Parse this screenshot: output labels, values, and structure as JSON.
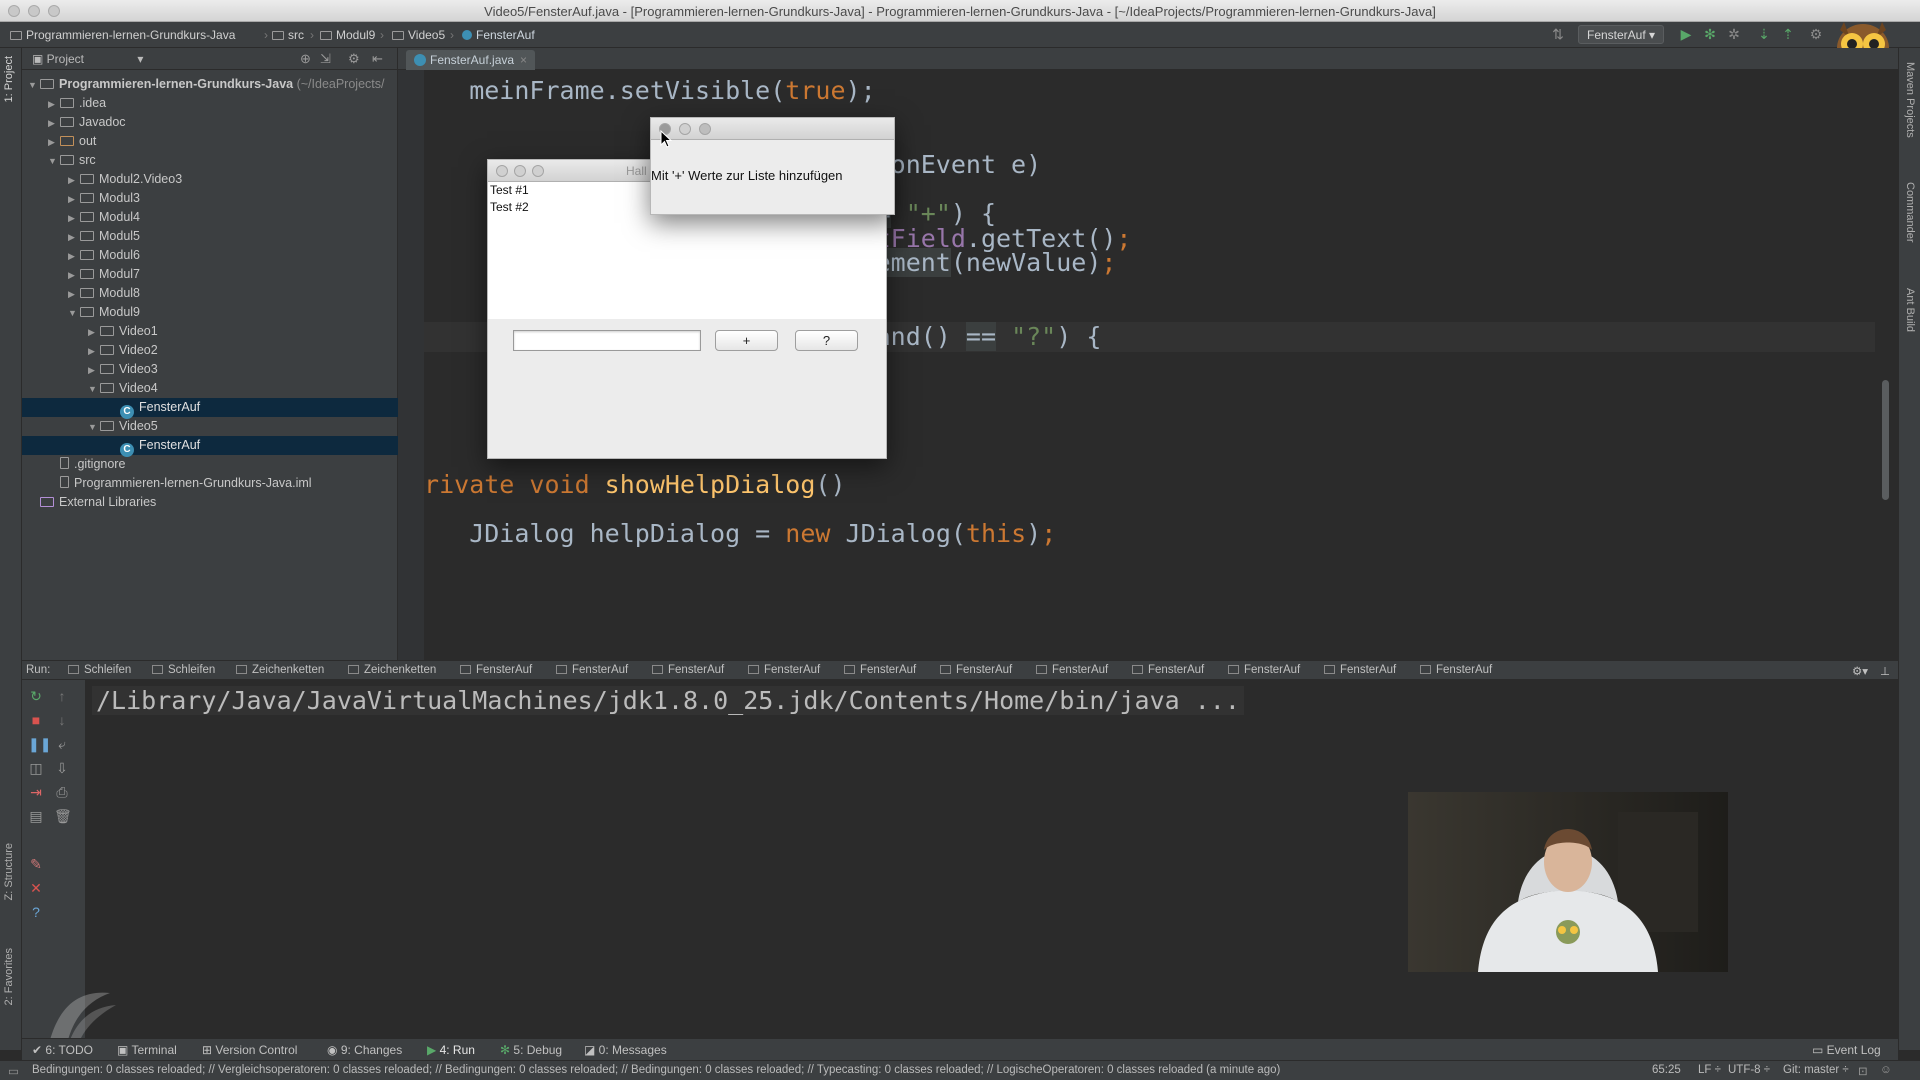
{
  "window": {
    "title": "Video5/FensterAuf.java - [Programmieren-lernen-Grundkurs-Java] - Programmieren-lernen-Grundkurs-Java - [~/IdeaProjects/Programmieren-lernen-Grundkurs-Java]"
  },
  "breadcrumb": [
    "Programmieren-lernen-Grundkurs-Java",
    "src",
    "Modul9",
    "Video5",
    "FensterAuf"
  ],
  "toolbar": {
    "run_config": "FensterAuf"
  },
  "project_panel": {
    "header": "Project",
    "tree": [
      {
        "label": "Programmieren-lernen-Grundkurs-Java",
        "note": "(~/IdeaProjects/",
        "depth": 0,
        "arrow": "down",
        "type": "folder"
      },
      {
        "label": ".idea",
        "depth": 1,
        "arrow": "right",
        "type": "folder"
      },
      {
        "label": "Javadoc",
        "depth": 1,
        "arrow": "right",
        "type": "folder"
      },
      {
        "label": "out",
        "depth": 1,
        "arrow": "right",
        "type": "folder"
      },
      {
        "label": "src",
        "depth": 1,
        "arrow": "down",
        "type": "folder"
      },
      {
        "label": "Modul2.Video3",
        "depth": 2,
        "arrow": "right",
        "type": "folder"
      },
      {
        "label": "Modul3",
        "depth": 2,
        "arrow": "right",
        "type": "folder"
      },
      {
        "label": "Modul4",
        "depth": 2,
        "arrow": "right",
        "type": "folder"
      },
      {
        "label": "Modul5",
        "depth": 2,
        "arrow": "right",
        "type": "folder"
      },
      {
        "label": "Modul6",
        "depth": 2,
        "arrow": "right",
        "type": "folder"
      },
      {
        "label": "Modul7",
        "depth": 2,
        "arrow": "right",
        "type": "folder"
      },
      {
        "label": "Modul8",
        "depth": 2,
        "arrow": "right",
        "type": "folder"
      },
      {
        "label": "Modul9",
        "depth": 2,
        "arrow": "down",
        "type": "folder"
      },
      {
        "label": "Video1",
        "depth": 3,
        "arrow": "right",
        "type": "folder"
      },
      {
        "label": "Video2",
        "depth": 3,
        "arrow": "right",
        "type": "folder"
      },
      {
        "label": "Video3",
        "depth": 3,
        "arrow": "right",
        "type": "folder"
      },
      {
        "label": "Video4",
        "depth": 3,
        "arrow": "down",
        "type": "folder"
      },
      {
        "label": "FensterAuf",
        "depth": 4,
        "arrow": "",
        "type": "class",
        "selected": true
      },
      {
        "label": "Video5",
        "depth": 3,
        "arrow": "down",
        "type": "folder"
      },
      {
        "label": "FensterAuf",
        "depth": 4,
        "arrow": "",
        "type": "class",
        "selected": true
      },
      {
        "label": ".gitignore",
        "depth": 1,
        "arrow": "",
        "type": "file"
      },
      {
        "label": "Programmieren-lernen-Grundkurs-Java.iml",
        "depth": 1,
        "arrow": "",
        "type": "file"
      },
      {
        "label": "External Libraries",
        "depth": 0,
        "arrow": "",
        "type": "lib"
      }
    ]
  },
  "editor": {
    "tab": "FensterAuf.java",
    "lines": [
      [
        [
          "var",
          "    meinFrame.setVisible("
        ],
        [
          "kw",
          "true"
        ],
        [
          "var",
          ");"
        ]
      ],
      [
        [
          "var",
          "}"
        ]
      ],
      [
        [
          "var",
          ""
        ]
      ],
      [
        [
          "var",
          "                           (ActionEvent e)"
        ]
      ],
      [
        [
          "var",
          ""
        ]
      ],
      [
        [
          "var",
          "                           () "
        ],
        [
          "box",
          "=="
        ],
        [
          "var",
          " "
        ],
        [
          "str",
          "\"+\""
        ],
        [
          "var",
          ") {"
        ]
      ],
      [
        [
          "var",
          "                           "
        ],
        [
          "pv",
          "inputField"
        ],
        [
          "var",
          ".getText()"
        ],
        [
          "kw",
          ";"
        ]
      ],
      [
        [
          "var",
          "                           "
        ],
        [
          "box",
          "ddElement"
        ],
        [
          "var",
          "(newValue)"
        ],
        [
          "kw",
          ";"
        ]
      ],
      [
        [
          "var",
          "                           ("
        ],
        [
          "str",
          "\"\""
        ],
        [
          "var",
          ")"
        ],
        [
          "kw",
          ";"
        ]
      ],
      [
        [
          "var",
          ""
        ]
      ],
      [
        [
          "var",
          "                           Command() "
        ],
        [
          "box",
          "=="
        ],
        [
          "var",
          " "
        ],
        [
          "str",
          "\"?\""
        ],
        [
          "var",
          ") {"
        ]
      ],
      [
        [
          "var",
          ""
        ]
      ],
      [
        [
          "var",
          ""
        ]
      ],
      [
        [
          "var",
          ""
        ]
      ],
      [
        [
          "var",
          "}"
        ]
      ],
      [
        [
          "var",
          ""
        ]
      ],
      [
        [
          "kw",
          "private void "
        ],
        [
          "fn",
          "showHelpDialog"
        ],
        [
          "var",
          "()"
        ]
      ],
      [
        [
          "var",
          "{"
        ]
      ],
      [
        [
          "var",
          "    JDialog helpDialog = "
        ],
        [
          "kw",
          "new "
        ],
        [
          "var",
          "JDialog("
        ],
        [
          "kw",
          "this"
        ],
        [
          "var",
          ")"
        ],
        [
          "kw",
          ";"
        ]
      ]
    ]
  },
  "app_window": {
    "title": "Hall",
    "list_items": [
      "Test #1",
      "Test #2"
    ],
    "input_value": "",
    "add_button": "+",
    "help_button": "?"
  },
  "help_dialog": {
    "message": "Mit '+' Werte zur Liste hinzufügen"
  },
  "run_panel": {
    "label": "Run:",
    "tabs": [
      "Schleifen",
      "Schleifen",
      "Zeichenketten",
      "Zeichenketten",
      "FensterAuf",
      "FensterAuf",
      "FensterAuf",
      "FensterAuf",
      "FensterAuf",
      "FensterAuf",
      "FensterAuf",
      "FensterAuf",
      "FensterAuf",
      "FensterAuf",
      "FensterAuf"
    ],
    "console": "/Library/Java/JavaVirtualMachines/jdk1.8.0_25.jdk/Contents/Home/bin/java ..."
  },
  "bottom_tabs": [
    "6: TODO",
    "Terminal",
    "Version Control",
    "9: Changes",
    "4: Run",
    "5: Debug",
    "0: Messages"
  ],
  "event_log": "Event Log",
  "side_tabs": {
    "left": [
      "1: Project",
      "Z: Structure",
      "2: Favorites"
    ],
    "right": [
      "Maven Projects",
      "Commander",
      "Ant Build"
    ]
  },
  "status": {
    "message": "Bedingungen: 0 classes reloaded; // Vergleichsoperatoren: 0 classes reloaded; // Bedingungen: 0 classes reloaded; // Bedingungen: 0 classes reloaded; // Typecasting: 0 classes reloaded; // LogischeOperatoren: 0 classes reloaded (a minute ago)",
    "position": "65:25",
    "line_sep": "LF ÷",
    "encoding": "UTF-8 ÷",
    "vcs": "Git: master ÷"
  },
  "colors": {
    "keyword": "#cc7832",
    "function": "#ffc66d",
    "string": "#6a8759",
    "field": "#9876aa",
    "selection": "#0d293e"
  }
}
